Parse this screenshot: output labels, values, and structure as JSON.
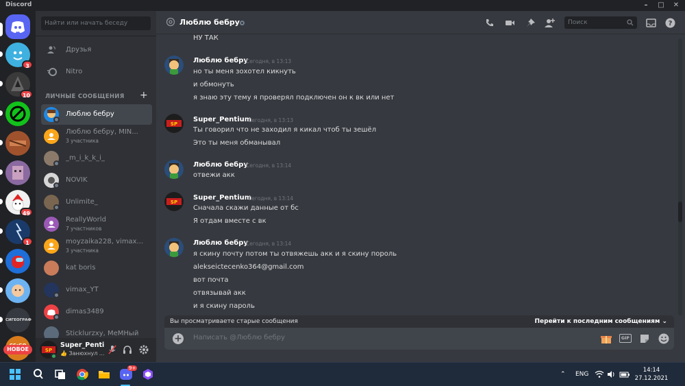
{
  "window": {
    "title": "Discord",
    "minimize_icon": "minimize-icon",
    "maximize_icon": "maximize-icon",
    "close_icon": "close-icon"
  },
  "servers": [
    {
      "name": "home",
      "badge": ""
    },
    {
      "name": "server-2",
      "badge": "3"
    },
    {
      "name": "server-3",
      "badge": "10"
    },
    {
      "name": "server-4",
      "badge": ""
    },
    {
      "name": "server-5",
      "badge": ""
    },
    {
      "name": "server-6",
      "badge": ""
    },
    {
      "name": "server-7",
      "badge": "49"
    },
    {
      "name": "server-8",
      "badge": "1"
    },
    {
      "name": "server-9",
      "badge": ""
    },
    {
      "name": "server-10",
      "badge": ""
    },
    {
      "name": "server-11",
      "label": "СИГЕОГРАФ"
    },
    {
      "name": "server-12",
      "label": "CS:GO"
    }
  ],
  "new_badge": "НОВОЕ",
  "sidebar": {
    "search_placeholder": "Найти или начать беседу",
    "friends": "Друзья",
    "nitro": "Nitro",
    "dm_header": "ЛИЧНЫЕ СООБЩЕНИЯ",
    "dms": [
      {
        "name": "Люблю бебру",
        "sub": "",
        "active": true
      },
      {
        "name": "Люблю бебру, MIN...",
        "sub": "3 участника"
      },
      {
        "name": "_m_i_k_k_i_",
        "sub": ""
      },
      {
        "name": "NOVIK",
        "sub": ""
      },
      {
        "name": "Unlimite_",
        "sub": ""
      },
      {
        "name": "ReallyWorld",
        "sub": "7 участников"
      },
      {
        "name": "moyzaika228, vimax...",
        "sub": "3 участника"
      },
      {
        "name": "kat boris",
        "sub": ""
      },
      {
        "name": "vimax_YT",
        "sub": ""
      },
      {
        "name": "dimas3489",
        "sub": ""
      },
      {
        "name": "Sticklurzxy, MeMHый",
        "sub": ""
      }
    ]
  },
  "user": {
    "name": "Super_Penti...",
    "status": "👍 Занюхнул ..."
  },
  "chat": {
    "title": "Люблю бебру",
    "search_placeholder": "Поиск",
    "top_line": "НУ ТАК",
    "groups": [
      {
        "author": "Люблю бебру",
        "time": "Сегодня, в 13:13",
        "lines": [
          "но ты меня зохотел кикнуть",
          "и обмонуть",
          "я знаю эту тему я проверял подключен он к вк или нет"
        ]
      },
      {
        "author": "Super_Pentium",
        "time": "Сегодня, в 13:13",
        "lines": [
          "Ты говорил что не заходил я кикал чтоб ты зешёл",
          "Это ты меня обманывал"
        ]
      },
      {
        "author": "Люблю бебру",
        "time": "Сегодня, в 13:14",
        "lines": [
          "отвежи акк"
        ]
      },
      {
        "author": "Super_Pentium",
        "time": "Сегодня, в 13:14",
        "lines": [
          "Сначала скажи данные от бс",
          "Я отдам вместе с вк"
        ]
      },
      {
        "author": "Люблю бебру",
        "time": "Сегодня, в 13:14",
        "lines": [
          "я скину почту потом ты отвяжешь акк и я скину пороль",
          "alekseictecenko364@gmail.com",
          "вот почта",
          "отвязывай акк",
          "и я скину пароль"
        ]
      }
    ],
    "old_messages": "Вы просматриваете старые сообщения",
    "jump": "Перейти к последним сообщениям",
    "composer_placeholder": "Написать @Люблю бебру",
    "gif": "GIF"
  },
  "taskbar": {
    "lang": "ENG",
    "time": "14:14",
    "date": "27.12.2021",
    "discord_badge": "9+"
  }
}
